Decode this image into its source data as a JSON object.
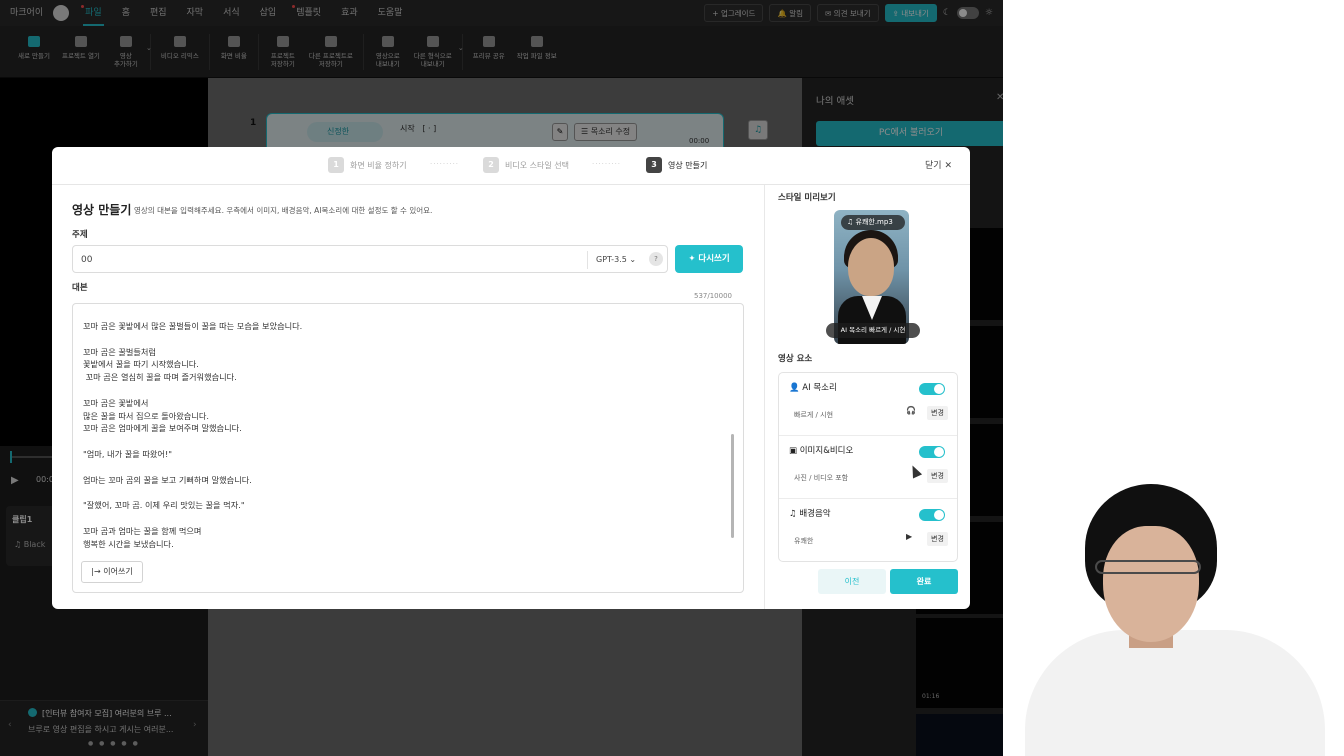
{
  "menubar": {
    "items": [
      "마크어이",
      "파일",
      "홈",
      "편집",
      "자막",
      "서식",
      "삽입",
      "템플릿",
      "효과",
      "도움말"
    ],
    "upgrade": "업그레이드",
    "alarm": "알림",
    "feedback": "의견 보내기",
    "export": "내보내기"
  },
  "toolbar": {
    "items": [
      "새로 만들기",
      "프로젝트 열기",
      "영상\n추가하기",
      "비디오 리믹스",
      "화면 비율",
      "프로젝트\n저장하기",
      "다른 프로젝트로\n저장하기",
      "영상으로\n내보내기",
      "다른 형식으로\n내보내기",
      "프리뷰 공유",
      "작업 파일 정보"
    ]
  },
  "left": {
    "time": "00:0",
    "clip_title": "클립1",
    "clip_music": "Black",
    "notice_title": "[인터뷰 참여자 모집] 여러분의 브루 ...",
    "notice_desc": "브루로 영상 편집을 하시고 게시는 여러분..."
  },
  "scene": {
    "number": "1",
    "speaker": "신정한",
    "start": "시작",
    "bracket": "[ · ]",
    "voice_edit": "목소리 수정",
    "time": "00:00"
  },
  "asset": {
    "title": "나의 애셋",
    "import": "PC에서 불러오기",
    "thumb_time": "01:16"
  },
  "modal": {
    "steps": [
      {
        "num": "1",
        "label": "화면 비율 정하기"
      },
      {
        "num": "2",
        "label": "비디오 스타일 선택"
      },
      {
        "num": "3",
        "label": "영상 만들기"
      }
    ],
    "close": "닫기",
    "title": "영상 만들기",
    "desc": "영상의 대본을 입력해주세요. 우측에서 이미지, 배경음악, AI목소리에 대한 설정도 할 수 있어요.",
    "subject_label": "주제",
    "subject_value": "00",
    "model": "GPT-3.5",
    "rewrite": "다시쓰기",
    "script_label": "대본",
    "script_count": "537/10000",
    "script": "꼬마 곰은 꽃밭에서 많은 꿀벌들이 꿀을 따는 모습을 보았습니다.\n\n꼬마 곰은 꿀벌들처럼\n꽃밭에서 꿀을 따기 시작했습니다.\n 꼬마 곰은 열심히 꿀을 따며 즐거워했습니다.\n\n꼬마 곰은 꽃밭에서\n많은 꿀을 따서 집으로 돌아왔습니다.\n꼬마 곰은 엄마에게 꿀을 보여주며 말했습니다.\n\n\"엄마, 내가 꿀을 따왔어!\"\n\n엄마는 꼬마 곰의 꿀을 보고 기뻐하며 말했습니다.\n\n\"잘했어, 꼬마 곰. 이제 우리 맛있는 꿀을 먹자.\"\n\n꼬마 곰과 엄마는 꿀을 함께 먹으며\n행복한 시간을 보냈습니다.",
    "continue": "이어쓰기",
    "preview_label": "스타일 미리보기",
    "preview_music": "유쾌한.mp3",
    "preview_voice": "AI 목소리 빠르게 / 시현",
    "elements_label": "영상 요소",
    "elements": [
      {
        "name": "AI 목소리",
        "sub": "빠르게 / 시현",
        "change": "변경"
      },
      {
        "name": "이미지&비디오",
        "sub": "사진 / 비디오 포함",
        "change": "변경"
      },
      {
        "name": "배경음악",
        "sub": "유쾌한",
        "change": "변경"
      }
    ],
    "prev": "이전",
    "done": "완료"
  },
  "colors": {
    "accent": "#25c0cc"
  }
}
